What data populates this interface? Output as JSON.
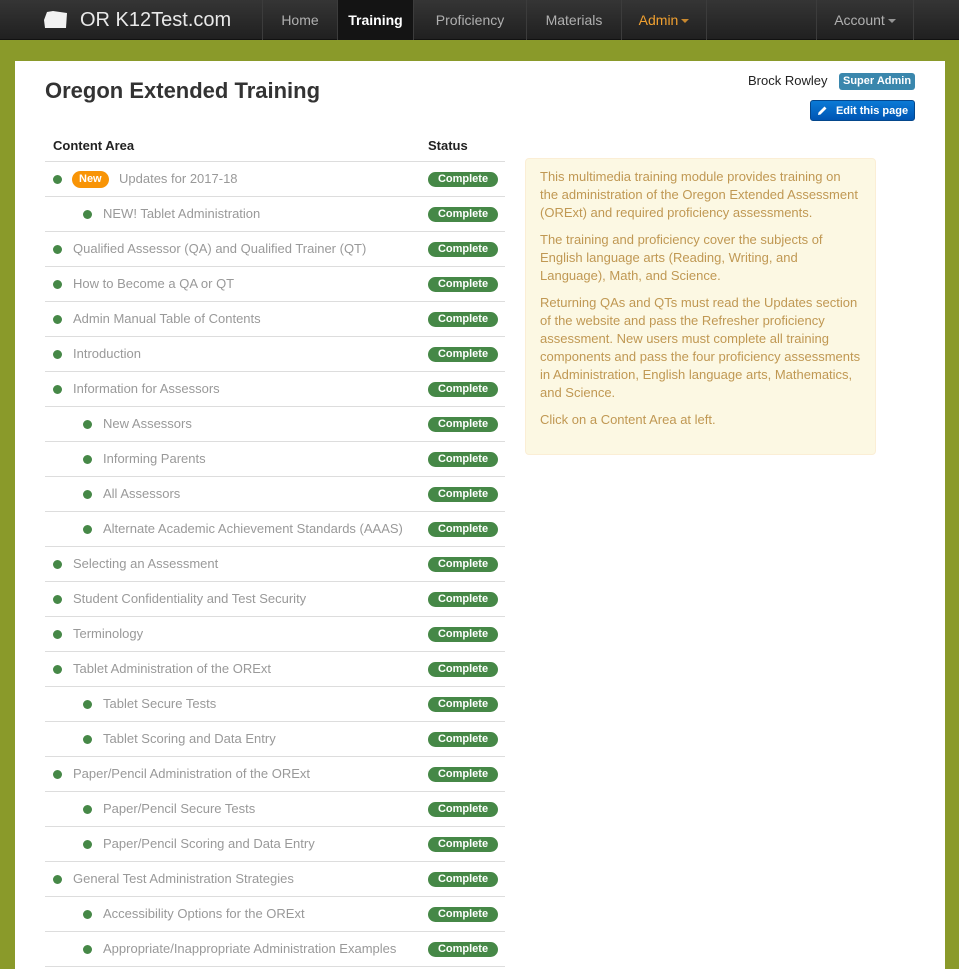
{
  "navbar": {
    "brand": "OR K12Test.com",
    "items": [
      {
        "label": "Home"
      },
      {
        "label": "Training"
      },
      {
        "label": "Proficiency"
      },
      {
        "label": "Materials"
      },
      {
        "label": "Admin"
      },
      {
        "label": "Account"
      }
    ]
  },
  "page": {
    "title": "Oregon Extended Training",
    "user_name": "Brock Rowley",
    "role": "Super Admin",
    "edit_label": "Edit this page"
  },
  "table": {
    "headers": {
      "content_area": "Content Area",
      "status": "Status"
    },
    "new_badge": "New",
    "rows": [
      {
        "label": "Updates for 2017-18",
        "status": "Complete"
      },
      {
        "label": "NEW! Tablet Administration",
        "status": "Complete"
      },
      {
        "label": "Qualified Assessor (QA) and Qualified Trainer (QT)",
        "status": "Complete"
      },
      {
        "label": "How to Become a QA or QT",
        "status": "Complete"
      },
      {
        "label": "Admin Manual Table of Contents",
        "status": "Complete"
      },
      {
        "label": "Introduction",
        "status": "Complete"
      },
      {
        "label": "Information for Assessors",
        "status": "Complete"
      },
      {
        "label": "New Assessors",
        "status": "Complete"
      },
      {
        "label": "Informing Parents",
        "status": "Complete"
      },
      {
        "label": "All Assessors",
        "status": "Complete"
      },
      {
        "label": "Alternate Academic Achievement Standards (AAAS)",
        "status": "Complete"
      },
      {
        "label": "Selecting an Assessment",
        "status": "Complete"
      },
      {
        "label": "Student Confidentiality and Test Security",
        "status": "Complete"
      },
      {
        "label": "Terminology",
        "status": "Complete"
      },
      {
        "label": "Tablet Administration of the ORExt",
        "status": "Complete"
      },
      {
        "label": "Tablet Secure Tests",
        "status": "Complete"
      },
      {
        "label": "Tablet Scoring and Data Entry",
        "status": "Complete"
      },
      {
        "label": "Paper/Pencil Administration of the ORExt",
        "status": "Complete"
      },
      {
        "label": "Paper/Pencil Secure Tests",
        "status": "Complete"
      },
      {
        "label": "Paper/Pencil Scoring and Data Entry",
        "status": "Complete"
      },
      {
        "label": "General Test Administration Strategies",
        "status": "Complete"
      },
      {
        "label": "Accessibility Options for the ORExt",
        "status": "Complete"
      },
      {
        "label": "Appropriate/Inappropriate Administration Examples",
        "status": "Complete"
      }
    ]
  },
  "info": {
    "paragraphs": [
      "This multimedia training module provides training on the administration of the Oregon Extended Assessment (ORExt) and required proficiency assessments.",
      "The training and proficiency cover the subjects of English language arts (Reading, Writing, and Language), Math, and Science.",
      "Returning QAs and QTs must read the Updates section of the website and pass the Refresher proficiency assessment. New users must complete all training components and pass the four proficiency assessments in Administration, English language arts, Mathematics, and Science.",
      "Click on a Content Area at left."
    ]
  },
  "colors": {
    "background": "#8a9a2a",
    "status_complete": "#468847",
    "new_badge": "#f89406",
    "role_badge": "#3a87ad",
    "info_text": "#c09853"
  }
}
